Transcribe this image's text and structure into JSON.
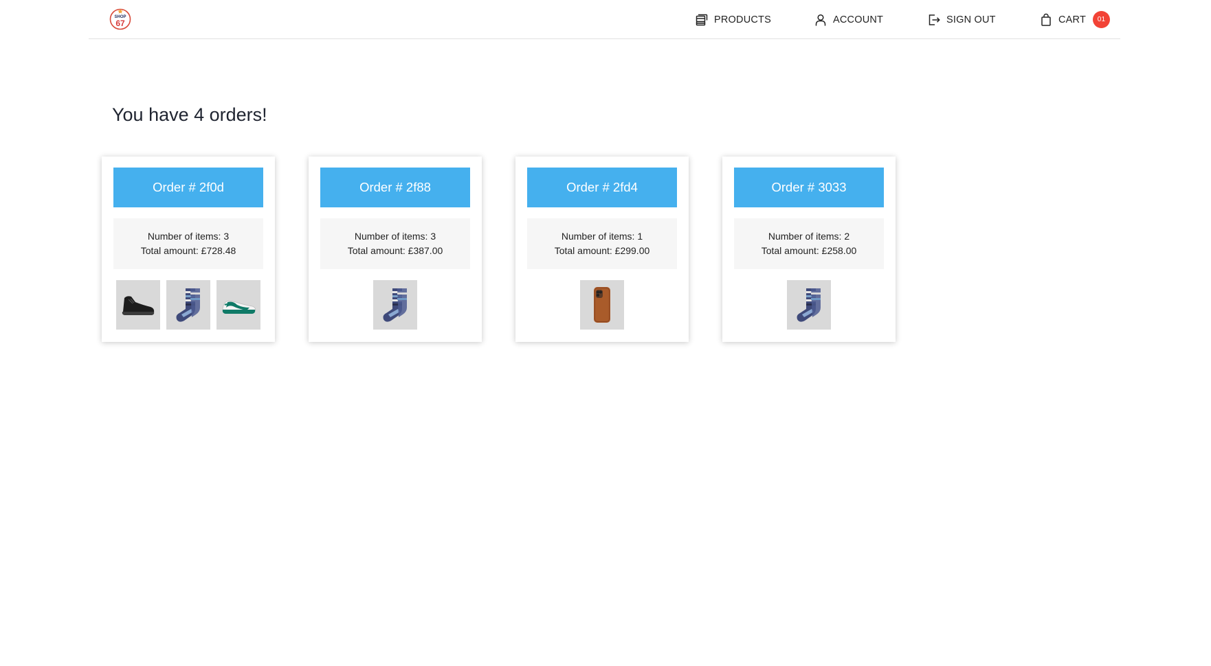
{
  "header": {
    "logo": {
      "icon": "shop67-logo",
      "text_top": "SHOP",
      "text_bottom": "67"
    },
    "nav": {
      "products": "PRODUCTS",
      "account": "ACCOUNT",
      "sign_out": "SIGN OUT",
      "cart": "CART",
      "cart_count": "01"
    }
  },
  "main": {
    "heading": "You have 4 orders!",
    "orders": [
      {
        "title": "Order # 2f0d",
        "items_text": "Number of items: 3",
        "total_text": "Total amount: £728.48",
        "products": [
          "black-sneaker",
          "striped-socks",
          "green-white-sneaker"
        ]
      },
      {
        "title": "Order # 2f88",
        "items_text": "Number of items: 3",
        "total_text": "Total amount: £387.00",
        "products": [
          "striped-socks"
        ]
      },
      {
        "title": "Order # 2fd4",
        "items_text": "Number of items: 1",
        "total_text": "Total amount: £299.00",
        "products": [
          "leather-phone-case"
        ]
      },
      {
        "title": "Order # 3033",
        "items_text": "Number of items: 2",
        "total_text": "Total amount: £258.00",
        "products": [
          "striped-socks"
        ]
      }
    ]
  },
  "colors": {
    "order_header": "#45b0ee",
    "cart_badge": "#f24336",
    "info_background": "#f6f6f6",
    "thumbnail_background": "#d9d9d9"
  }
}
